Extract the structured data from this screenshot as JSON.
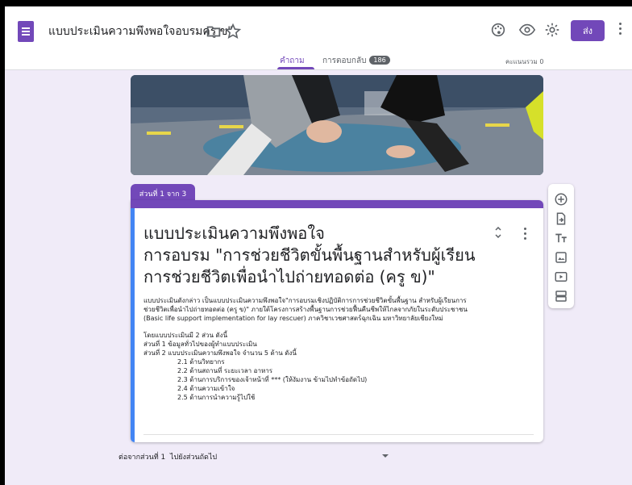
{
  "header": {
    "title": "แบบประเมินความพึงพอใจอบรมครู ข\"",
    "send_label": "ส่ง"
  },
  "tabs": {
    "questions_label": "คำถาม",
    "responses_label": "การตอบกลับ",
    "responses_count": "186",
    "score_label": "คะแนนรวม 0"
  },
  "section": {
    "tab_label": "ส่วนที่ 1 จาก 3",
    "title_lines": [
      "แบบประเมินความพึงพอใจ",
      "การอบรม \"การช่วยชีวิตขั้นพื้นฐานสำหรับผู้เรียน",
      "การช่วยชีวิตเพื่อนำไปถ่ายทอดต่อ (ครู ข)\""
    ],
    "description": [
      "แบบประเมินดังกล่าว เป็นแบบประเมินความพึงพอใจ\"การอบรมเชิงปฏิบัติการการช่วยชีวิตขั้นพื้นฐาน สำหรับผู้เรียนการ",
      "ช่วยชีวิตเพื่อนำไปถ่ายทอดต่อ (ครู ข)\" ภายใต้โครงการสร้างพื้นฐานการช่วยฟื้นคืนชีพให้ไกลจากภัยในระดับประชาชน",
      "(Basic life support implementation for lay rescuer) ภาควิชาเวชศาสตร์ฉุกเฉิน มหาวิทยาลัยเชียงใหม่"
    ],
    "outline_intro": [
      "โดยแบบประเมินมี 2 ส่วน ดังนี้",
      "ส่วนที่ 1 ข้อมูลทั่วไปของผู้ทำแบบประเมิน",
      "ส่วนที่ 2 แบบประเมินความพึงพอใจ จำนวน 5 ด้าน ดังนี้"
    ],
    "outline_items": [
      "2.1 ด้านวิทยากร",
      "2.2 ด้านสถานที่ ระยะเวลา อาหาร",
      "2.3 ด้านการบริการของเจ้าหน้าที่ *** (ให้งัมงาน ข้ามไปทำข้อถัดไป)",
      "2.4 ด้านความเข้าใจ",
      "2.5 ด้านการนำความรู้ไปใช้"
    ]
  },
  "after_section": {
    "label": "ต่อจากส่วนที่ 1",
    "value": "ไปยังส่วนถัดไป"
  },
  "icons": {
    "header": [
      "folder-icon",
      "star-icon",
      "palette-icon",
      "eye-icon",
      "settings-icon",
      "more-vert-icon"
    ],
    "toolbar": [
      "add-question-icon",
      "import-questions-icon",
      "add-title-icon",
      "add-image-icon",
      "add-video-icon",
      "add-section-icon"
    ]
  },
  "colors": {
    "accent": "#7248b9",
    "background": "#f0ebf8",
    "section_bar": "#4285f4"
  }
}
